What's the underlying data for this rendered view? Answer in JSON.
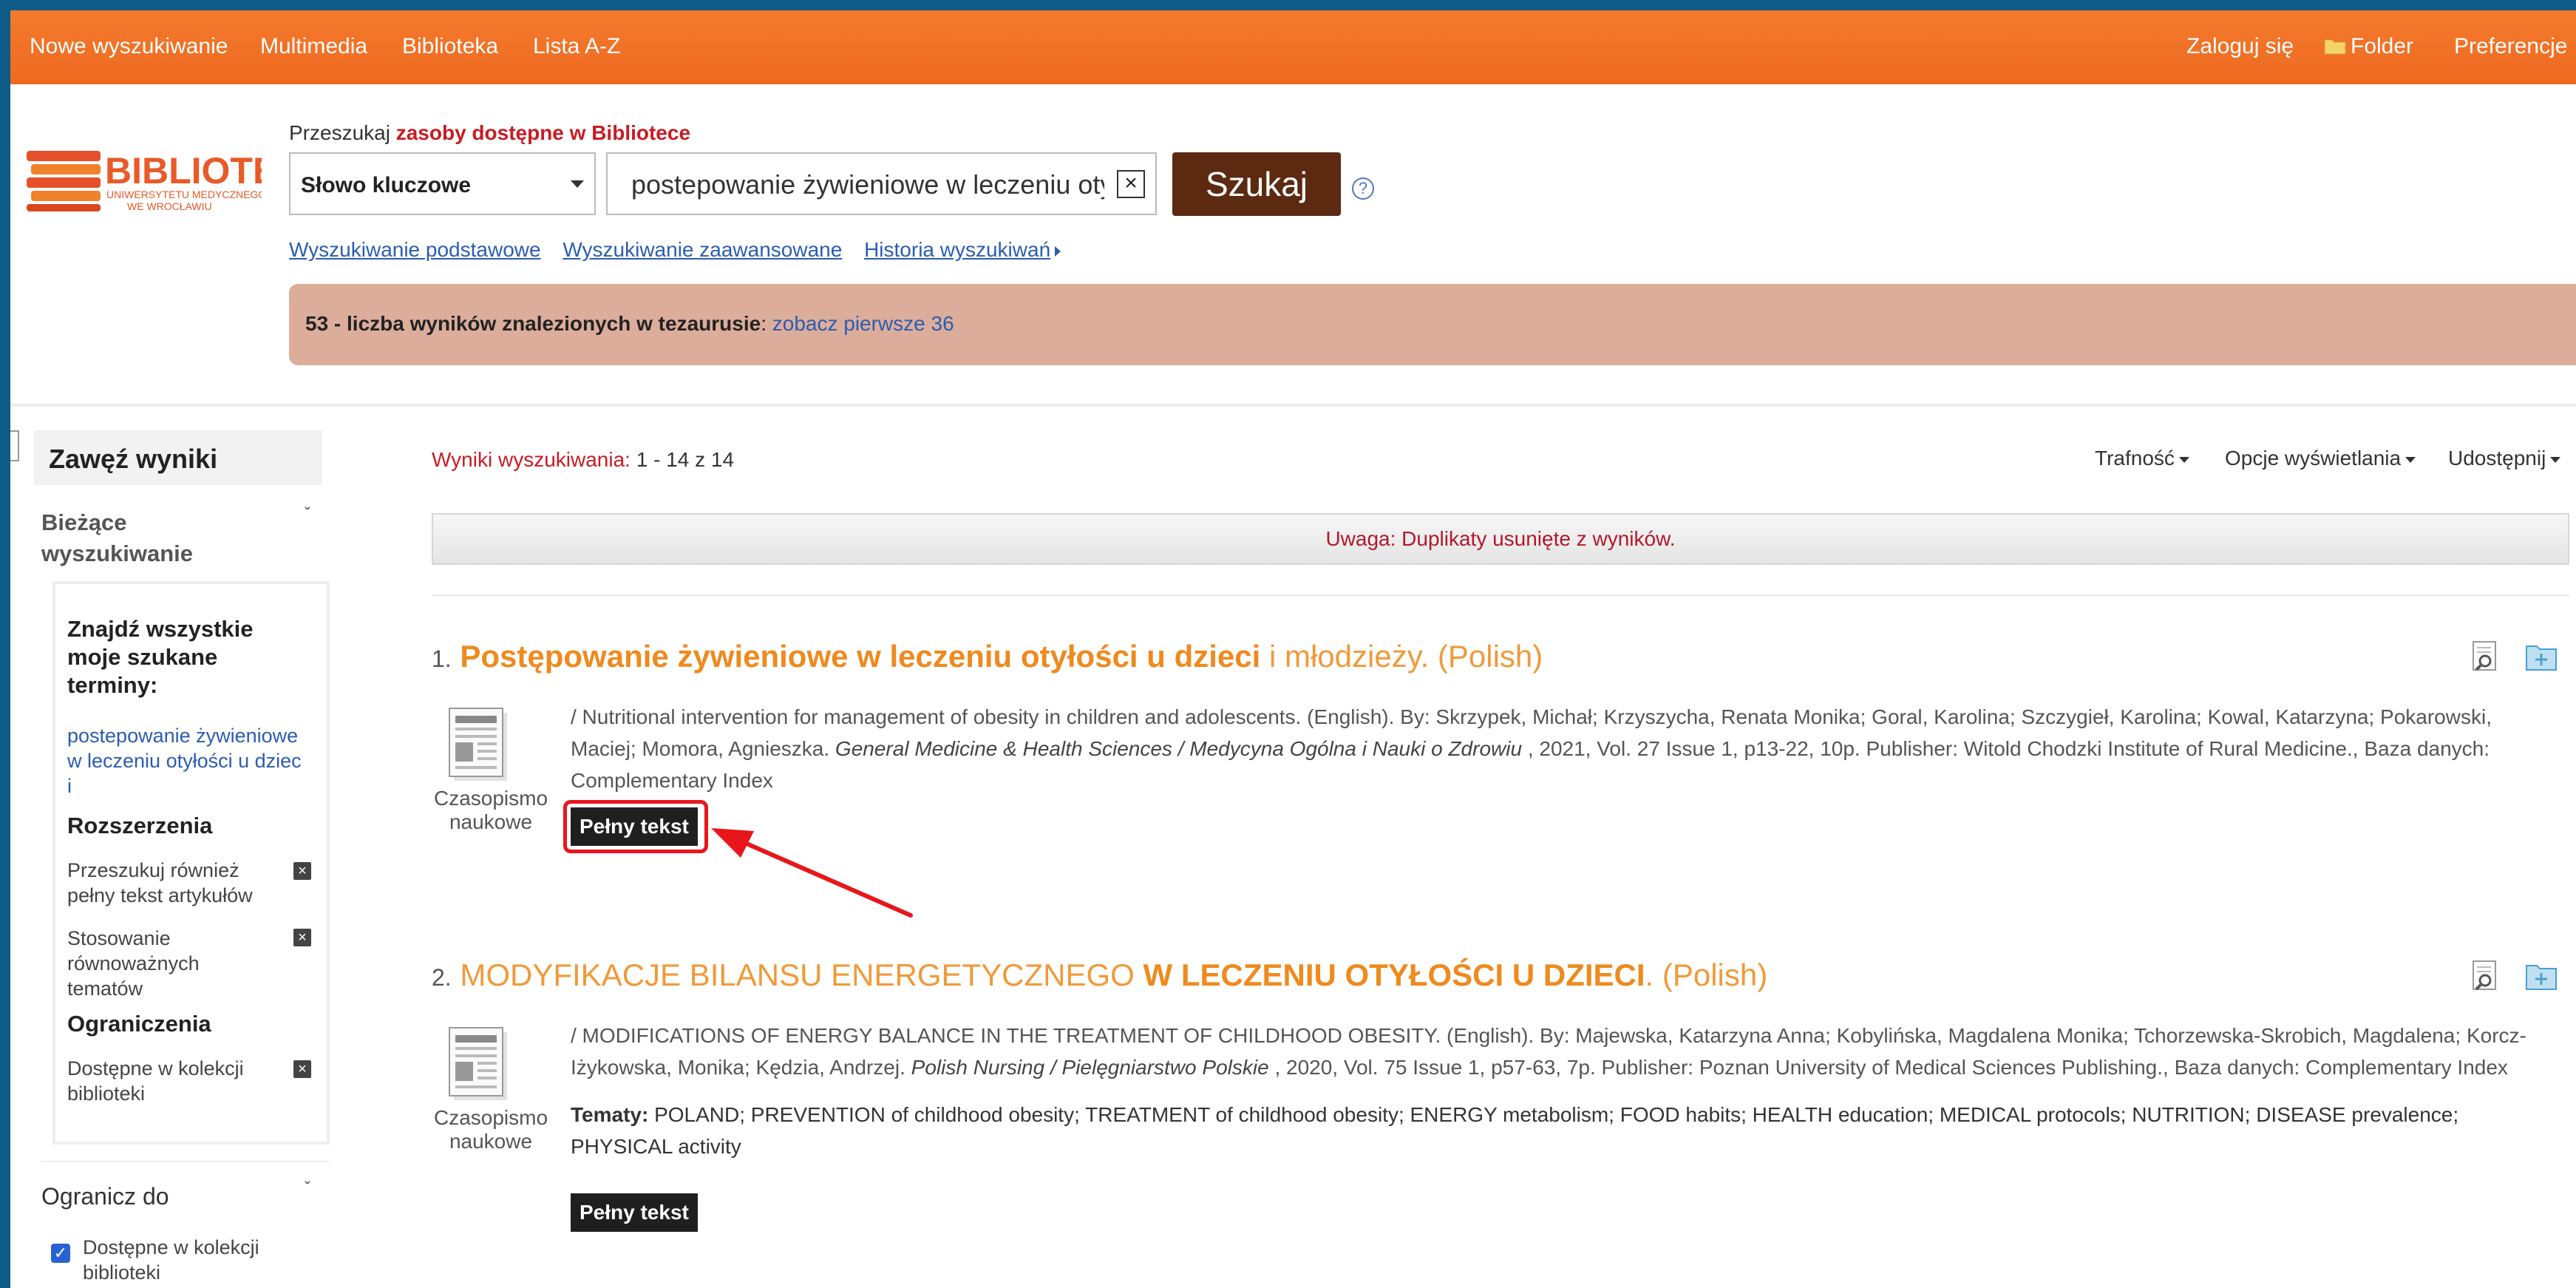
{
  "nav": {
    "left": [
      "Nowe wyszukiwanie",
      "Multimedia",
      "Biblioteka",
      "Lista A-Z"
    ],
    "login": "Zaloguj się",
    "folder": "Folder",
    "preferences": "Preferencje"
  },
  "logo": {
    "name": "BIBLIOTEKA",
    "sub1": "UNIWERSYTETU MEDYCZNEGO",
    "sub2": "WE WROCŁAWIU"
  },
  "search": {
    "caption_prefix": "Przeszukaj",
    "caption_emph": "zasoby dostępne w Bibliotece",
    "field": "Słowo kluczowe",
    "query": "postepowanie żywieniowe w leczeniu otyłości u dzieci i",
    "button": "Szukaj",
    "help": "?",
    "clear": "×",
    "links": {
      "basic": "Wyszukiwanie podstawowe",
      "advanced": "Wyszukiwanie zaawansowane",
      "history": "Historia wyszukiwań"
    },
    "thesaurus_count": "53 - liczba wyników znalezionych w tezaurusie",
    "thesaurus_link": "zobacz pierwsze 36"
  },
  "sidebar": {
    "refine_title": "Zawęź wyniki",
    "current_title_1": "Bieżące",
    "current_title_2": "wyszukiwanie",
    "find_all_1": "Znajdź wszystkie",
    "find_all_2": "moje szukane",
    "find_all_3": "terminy:",
    "term_1": "postepowanie żywieniowe",
    "term_2": "w leczeniu otyłości u dziec",
    "term_3": "i",
    "expanders_title": "Rozszerzenia",
    "exp1_1": "Przeszukuj również",
    "exp1_2": "pełny tekst artykułów",
    "exp2_1": "Stosowanie",
    "exp2_2": "równoważnych",
    "exp2_3": "tematów",
    "limits_title": "Ograniczenia",
    "lim1_1": "Dostępne w kolekcji",
    "lim1_2": "biblioteki",
    "limit_to": "Ogranicz do",
    "limit_check_1": "Dostępne w kolekcji",
    "limit_check_2": "biblioteki"
  },
  "results": {
    "count_label": "Wyniki wyszukiwania:",
    "count_value": "1 - 14 z 14",
    "sort": "Trafność",
    "display_options": "Opcje wyświetlania",
    "share": "Udostępnij",
    "duplicates_note": "Uwaga: Duplikaty usunięte z wyników.",
    "items": [
      {
        "num": "1.",
        "title_bold": "Postępowanie żywieniowe w leczeniu otyłości u dzieci",
        "title_rest": "i młodzieży. (Polish)",
        "type_1": "Czasopismo",
        "type_2": "naukowe",
        "desc_a": "/ Nutritional intervention for management of obesity in children and adolescents. (English). By: Skrzypek, Michał; Krzyszycha, Renata Monika; Goral, Karolina; Szczygieł, Karolina; Kowal, Katarzyna; Pokarowski,",
        "desc_b1": "Maciej; Momora, Agnieszka.",
        "desc_b_journal": "General Medicine & Health Sciences / Medycyna Ogólna i Nauki o Zdrowiu",
        "desc_b2": ", 2021, Vol. 27 Issue 1, p13-22, 10p. Publisher: Witold Chodzki Institute of Rural Medicine., Baza danych:",
        "desc_c": "Complementary Index",
        "fulltext": "Pełny tekst"
      },
      {
        "num": "2.",
        "title_a": "MODYFIKACJE BILANSU ENERGETYCZNEGO",
        "title_bold": "W LECZENIU OTYŁOŚCI U DZIECI",
        "title_rest": ". (Polish)",
        "type_1": "Czasopismo",
        "type_2": "naukowe",
        "desc_a": "/ MODIFICATIONS OF ENERGY BALANCE IN THE TREATMENT OF CHILDHOOD OBESITY. (English). By: Majewska, Katarzyna Anna; Kobylińska, Magdalena Monika; Tchorzewska-Skrobich, Magdalena; Korcz-",
        "desc_b1": "Iżykowska, Monika; Kędzia, Andrzej.",
        "desc_b_journal": "Polish Nursing / Pielęgniarstwo Polskie",
        "desc_b2": ", 2020, Vol. 75 Issue 1, p57-63, 7p. Publisher: Poznan University of Medical Sciences Publishing., Baza danych: Complementary Index",
        "subjects_label": "Tematy:",
        "subjects_a": "POLAND; PREVENTION of childhood obesity; TREATMENT of childhood obesity; ENERGY metabolism; FOOD habits; HEALTH education; MEDICAL protocols; NUTRITION; DISEASE prevalence;",
        "subjects_b": "PHYSICAL activity",
        "fulltext": "Pełny tekst"
      }
    ]
  }
}
